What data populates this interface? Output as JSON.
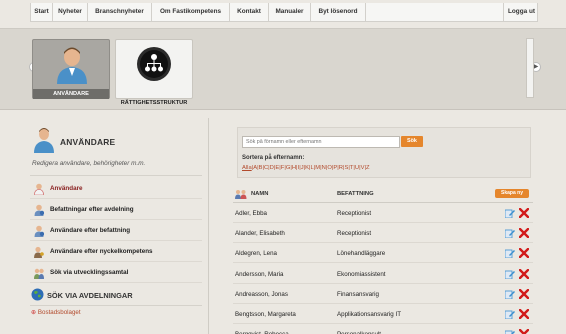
{
  "nav": {
    "items": [
      "Start",
      "Nyheter",
      "Branschnyheter",
      "Om Fastikompetens",
      "Kontakt",
      "Manualer",
      "Byt lösenord"
    ],
    "logout": "Logga ut"
  },
  "modules": [
    {
      "label": "ANVÄNDARE",
      "icon": "user-icon",
      "active": true
    },
    {
      "label": "RÄTTIGHETSSTRUKTUR",
      "icon": "hierarchy-icon",
      "active": false
    }
  ],
  "sidebar": {
    "title": "ANVÄNDARE",
    "subtitle": "Redigera användare, behörigheter m.m.",
    "items": [
      {
        "label": "Användare",
        "icon": "user-icon"
      },
      {
        "label": "Befattningar efter avdelning",
        "icon": "user-info-icon"
      },
      {
        "label": "Användare efter befattning",
        "icon": "user-info-icon"
      },
      {
        "label": "Användare efter nyckelkompetens",
        "icon": "users-key-icon"
      },
      {
        "label": "Sök via utvecklingssamtal",
        "icon": "users-talk-icon"
      }
    ],
    "section2_title": "SÖK VIA AVDELNINGAR",
    "tree_item": "Bostadsbolaget"
  },
  "search": {
    "placeholder": "Sök på förnamn eller efternamn",
    "button": "Sök",
    "sort_label": "Sortera på efternamn:",
    "letters": [
      "Alla",
      "A",
      "B",
      "C",
      "D",
      "E",
      "F",
      "G",
      "H",
      "I",
      "J",
      "K",
      "L",
      "M",
      "N",
      "O",
      "P",
      "R",
      "S",
      "T",
      "U",
      "V",
      "Z"
    ]
  },
  "table": {
    "col_name": "NAMN",
    "col_role": "BEFATTNING",
    "add_button": "Skapa ny",
    "rows": [
      {
        "name": "Adler, Ebba",
        "role": "Receptionist"
      },
      {
        "name": "Alander, Elisabeth",
        "role": "Receptionist"
      },
      {
        "name": "Aldegren, Lena",
        "role": "Lönehandläggare"
      },
      {
        "name": "Andersson, Maria",
        "role": "Ekonomiassistent"
      },
      {
        "name": "Andreasson, Jonas",
        "role": "Finansansvarig"
      },
      {
        "name": "Bengtsson, Margareta",
        "role": "Applikationsansvarig IT"
      },
      {
        "name": "Bergqvist, Rebecca",
        "role": "Personalkonsult"
      }
    ]
  },
  "colors": {
    "accent": "#e5862c",
    "link": "#b24a2c",
    "delete": "#d11a1a",
    "edit": "#3b8fd0"
  }
}
